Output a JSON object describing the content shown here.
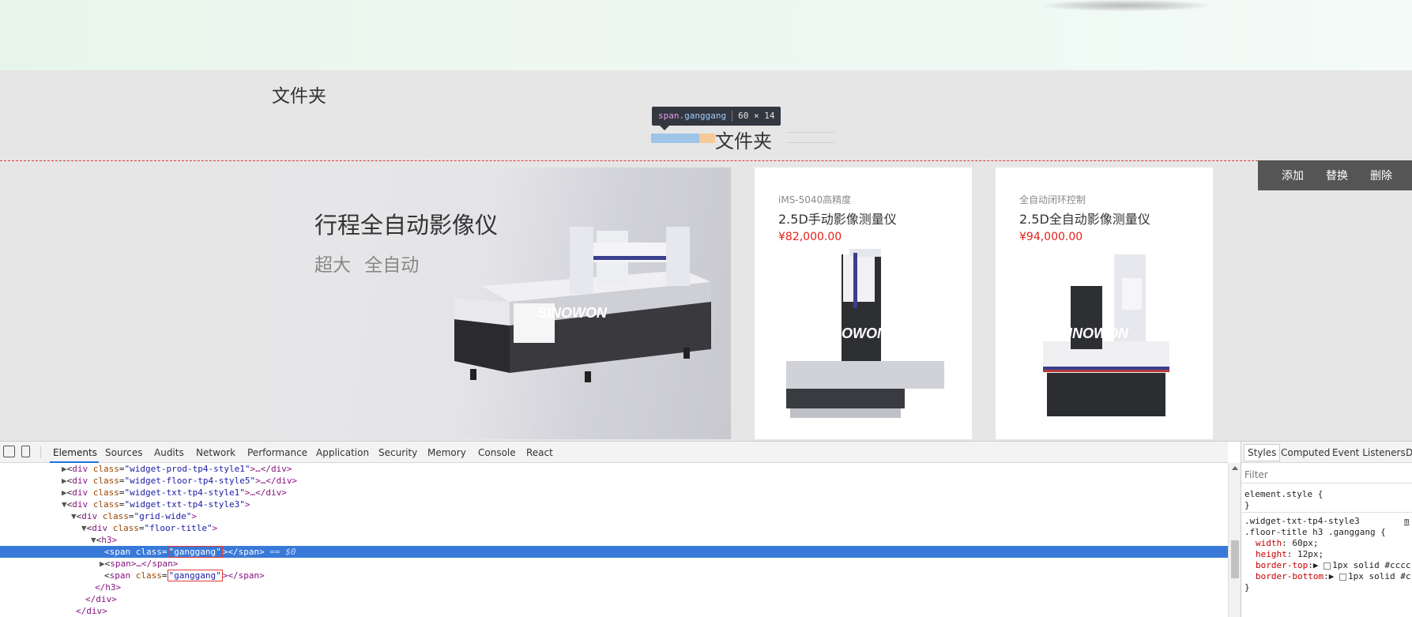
{
  "section": {
    "title": "文件夹",
    "center_title": "文件夹"
  },
  "tooltip": {
    "tag": "span",
    "cls": ".ganggang",
    "size": "60 × 14"
  },
  "actions": [
    "添加",
    "替换",
    "删除"
  ],
  "products": {
    "featured": {
      "title": "行程全自动影像仪",
      "subtitle": "超大 全自动"
    },
    "items": [
      {
        "top": "iMS-5040高精度",
        "name": "2.5D手动影像测量仪",
        "price": "¥82,000.00"
      },
      {
        "top": "全自动闭环控制",
        "name": "2.5D全自动影像测量仪",
        "price": "¥94,000.00"
      }
    ],
    "brand": "SINOWON"
  },
  "devtools": {
    "tabs": [
      "Elements",
      "Sources",
      "Audits",
      "Network",
      "Performance",
      "Application",
      "Security",
      "Memory",
      "Console",
      "React"
    ],
    "dom_rows": [
      {
        "tri": "▶",
        "tag": "div",
        "an": "class",
        "av": "widget-prod-tp4-style1",
        "tail": ">…</div>"
      },
      {
        "tri": "▶",
        "tag": "div",
        "an": "class",
        "av": "widget-floor-tp4-style5",
        "tail": ">…</div>"
      },
      {
        "tri": "▶",
        "tag": "div",
        "an": "class",
        "av": "widget-txt-tp4-style1",
        "tail": ">…</div>"
      },
      {
        "tri": "▼",
        "tag": "div",
        "an": "class",
        "av": "widget-txt-tp4-style3",
        "tail": ">"
      },
      {
        "tri": "▼",
        "tag": "div",
        "an": "class",
        "av": "grid-wide",
        "tail": ">"
      },
      {
        "tri": "▼",
        "tag": "div",
        "an": "class",
        "av": "floor-title",
        "tail": ">"
      },
      {
        "tri": "▼",
        "tag": "h3",
        "an": "",
        "av": "",
        "tail": ">"
      },
      {
        "tri": "",
        "tag": "span",
        "an": "class",
        "av": "ganggang",
        "tail": "></span>",
        "eq": "== $0"
      },
      {
        "tri": "▶",
        "tag": "span",
        "an": "",
        "av": "",
        "tail": ">…</span>"
      },
      {
        "tri": "",
        "tag": "span",
        "an": "class",
        "av": "ganggang",
        "tail": "></span>"
      },
      {
        "tri": "",
        "tag": "",
        "an": "",
        "av": "",
        "tail": "</h3>"
      },
      {
        "tri": "",
        "tag": "",
        "an": "",
        "av": "",
        "tail": "</div>"
      },
      {
        "tri": "",
        "tag": "",
        "an": "",
        "av": "",
        "tail": "</div>"
      }
    ],
    "styles": {
      "tabs": [
        "Styles",
        "Computed",
        "Event Listeners",
        "D"
      ],
      "filter": "Filter",
      "element_style": "element.style {",
      "close": "}",
      "selector1": ".widget-txt-tp4-style3",
      "selector2": ".floor-title h3 .ganggang {",
      "source": "m",
      "props": [
        {
          "name": "width",
          "value": "60px;"
        },
        {
          "name": "height",
          "value": "12px;"
        },
        {
          "name": "border-top",
          "value": "1px solid #cccc"
        },
        {
          "name": "border-bottom",
          "value": "1px solid #c"
        }
      ]
    }
  }
}
